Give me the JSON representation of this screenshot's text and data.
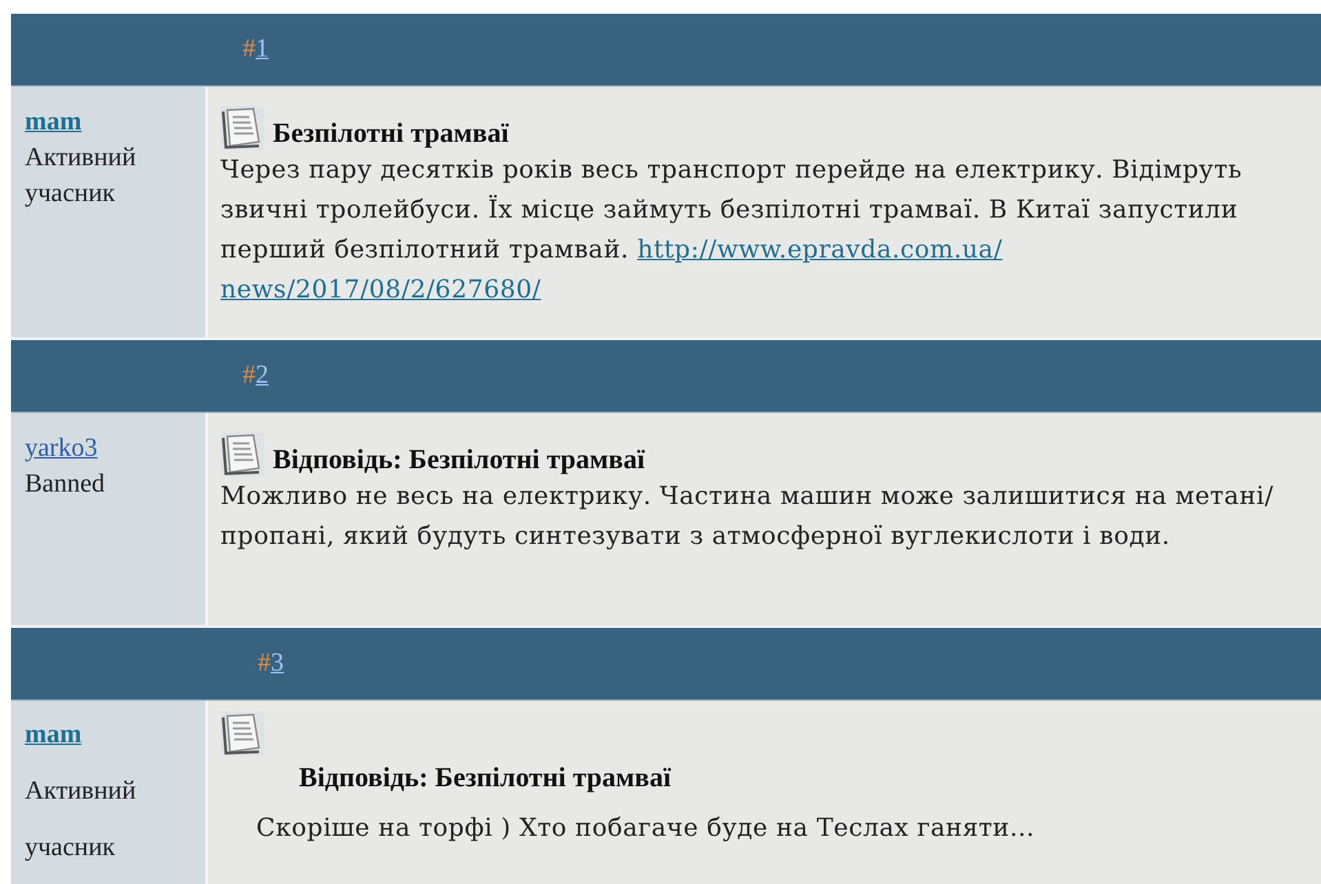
{
  "posts": [
    {
      "number_prefix": "#",
      "number": "1",
      "author": {
        "name": "mam",
        "bold": true,
        "rank": [
          "Активний",
          "учасник"
        ]
      },
      "title": "Безпілотні трамваї",
      "body": "Через пару десятків років весь транспорт перейде на електрику. Відімруть звичні тролейбуси. Їх місце займуть безпілотні трамваї. В Китаї запустили перший безпілотний трамвай.",
      "link_lines": [
        "http://www.epravda.com.ua/",
        "news/2017/08/2/627680/"
      ],
      "spaced": false
    },
    {
      "number_prefix": "#",
      "number": "2",
      "author": {
        "name": "yarko3",
        "bold": false,
        "rank": [
          "Banned"
        ]
      },
      "title": "Відповідь: Безпілотні трамваї",
      "body": "Можливо не весь на електрику. Частина машин може залишитися на метані/пропані, який будуть синтезувати з атмосферної вуглекислоти і води.",
      "spaced": false
    },
    {
      "number_prefix": "#",
      "number": "3",
      "author": {
        "name": "mam",
        "bold": true,
        "rank": [
          "Активний",
          "учасник"
        ]
      },
      "title": "Відповідь: Безпілотні трамваї",
      "body": "Скоріше на торфі ) Хто побагаче буде на Теслах ганяти...",
      "spaced": true
    }
  ]
}
